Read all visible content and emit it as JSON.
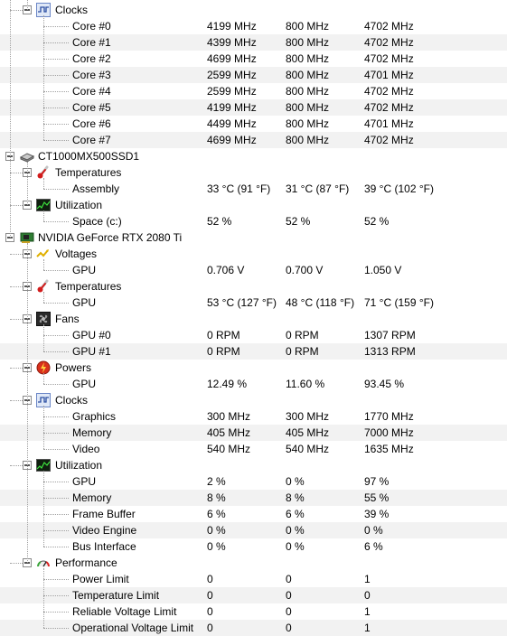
{
  "tree": [
    {
      "level": 1,
      "type": "group",
      "icon": "clock-wave-icon",
      "label": "Clocks"
    },
    {
      "level": 2,
      "type": "leaf",
      "label": "Core #0",
      "v1": "4199 MHz",
      "v2": "800 MHz",
      "v3": "4702 MHz"
    },
    {
      "level": 2,
      "type": "leaf",
      "label": "Core #1",
      "v1": "4399 MHz",
      "v2": "800 MHz",
      "v3": "4702 MHz"
    },
    {
      "level": 2,
      "type": "leaf",
      "label": "Core #2",
      "v1": "4699 MHz",
      "v2": "800 MHz",
      "v3": "4702 MHz"
    },
    {
      "level": 2,
      "type": "leaf",
      "label": "Core #3",
      "v1": "2599 MHz",
      "v2": "800 MHz",
      "v3": "4701 MHz"
    },
    {
      "level": 2,
      "type": "leaf",
      "label": "Core #4",
      "v1": "2599 MHz",
      "v2": "800 MHz",
      "v3": "4702 MHz"
    },
    {
      "level": 2,
      "type": "leaf",
      "label": "Core #5",
      "v1": "4199 MHz",
      "v2": "800 MHz",
      "v3": "4702 MHz"
    },
    {
      "level": 2,
      "type": "leaf",
      "label": "Core #6",
      "v1": "4499 MHz",
      "v2": "800 MHz",
      "v3": "4701 MHz"
    },
    {
      "level": 2,
      "type": "leaf",
      "label": "Core #7",
      "v1": "4699 MHz",
      "v2": "800 MHz",
      "v3": "4702 MHz"
    },
    {
      "level": 0,
      "type": "device",
      "icon": "ssd-drive-icon",
      "label": "CT1000MX500SSD1"
    },
    {
      "level": 1,
      "type": "group",
      "icon": "thermometer-icon",
      "label": "Temperatures"
    },
    {
      "level": 2,
      "type": "leaf",
      "label": "Assembly",
      "v1": "33 °C  (91 °F)",
      "v2": "31 °C  (87 °F)",
      "v3": "39 °C  (102 °F)"
    },
    {
      "level": 1,
      "type": "group",
      "icon": "utilization-graph-icon",
      "label": "Utilization"
    },
    {
      "level": 2,
      "type": "leaf",
      "label": "Space (c:)",
      "v1": "52 %",
      "v2": "52 %",
      "v3": "52 %"
    },
    {
      "level": 0,
      "type": "device",
      "icon": "gpu-card-icon",
      "label": "NVIDIA GeForce RTX 2080 Ti"
    },
    {
      "level": 1,
      "type": "group",
      "icon": "voltage-icon",
      "label": "Voltages"
    },
    {
      "level": 2,
      "type": "leaf",
      "label": "GPU",
      "v1": "0.706 V",
      "v2": "0.700 V",
      "v3": "1.050 V"
    },
    {
      "level": 1,
      "type": "group",
      "icon": "thermometer-icon",
      "label": "Temperatures"
    },
    {
      "level": 2,
      "type": "leaf",
      "label": "GPU",
      "v1": "53 °C  (127 °F)",
      "v2": "48 °C  (118 °F)",
      "v3": "71 °C  (159 °F)"
    },
    {
      "level": 1,
      "type": "group",
      "icon": "fan-icon",
      "label": "Fans"
    },
    {
      "level": 2,
      "type": "leaf",
      "label": "GPU #0",
      "v1": "0 RPM",
      "v2": "0 RPM",
      "v3": "1307 RPM"
    },
    {
      "level": 2,
      "type": "leaf",
      "label": "GPU #1",
      "v1": "0 RPM",
      "v2": "0 RPM",
      "v3": "1313 RPM"
    },
    {
      "level": 1,
      "type": "group",
      "icon": "power-icon",
      "label": "Powers"
    },
    {
      "level": 2,
      "type": "leaf",
      "label": "GPU",
      "v1": "12.49 %",
      "v2": "11.60 %",
      "v3": "93.45 %"
    },
    {
      "level": 1,
      "type": "group",
      "icon": "clock-wave-icon",
      "label": "Clocks"
    },
    {
      "level": 2,
      "type": "leaf",
      "label": "Graphics",
      "v1": "300 MHz",
      "v2": "300 MHz",
      "v3": "1770 MHz"
    },
    {
      "level": 2,
      "type": "leaf",
      "label": "Memory",
      "v1": "405 MHz",
      "v2": "405 MHz",
      "v3": "7000 MHz"
    },
    {
      "level": 2,
      "type": "leaf",
      "label": "Video",
      "v1": "540 MHz",
      "v2": "540 MHz",
      "v3": "1635 MHz"
    },
    {
      "level": 1,
      "type": "group",
      "icon": "utilization-graph-icon",
      "label": "Utilization"
    },
    {
      "level": 2,
      "type": "leaf",
      "label": "GPU",
      "v1": "2 %",
      "v2": "0 %",
      "v3": "97 %"
    },
    {
      "level": 2,
      "type": "leaf",
      "label": "Memory",
      "v1": "8 %",
      "v2": "8 %",
      "v3": "55 %"
    },
    {
      "level": 2,
      "type": "leaf",
      "label": "Frame Buffer",
      "v1": "6 %",
      "v2": "6 %",
      "v3": "39 %"
    },
    {
      "level": 2,
      "type": "leaf",
      "label": "Video Engine",
      "v1": "0 %",
      "v2": "0 %",
      "v3": "0 %"
    },
    {
      "level": 2,
      "type": "leaf",
      "label": "Bus Interface",
      "v1": "0 %",
      "v2": "0 %",
      "v3": "6 %"
    },
    {
      "level": 1,
      "type": "group",
      "icon": "performance-gauge-icon",
      "label": "Performance"
    },
    {
      "level": 2,
      "type": "leaf",
      "label": "Power Limit",
      "v1": "0",
      "v2": "0",
      "v3": "1"
    },
    {
      "level": 2,
      "type": "leaf",
      "label": "Temperature Limit",
      "v1": "0",
      "v2": "0",
      "v3": "0"
    },
    {
      "level": 2,
      "type": "leaf",
      "label": "Reliable Voltage Limit",
      "v1": "0",
      "v2": "0",
      "v3": "1"
    },
    {
      "level": 2,
      "type": "leaf",
      "label": "Operational Voltage Limit",
      "v1": "0",
      "v2": "0",
      "v3": "1"
    }
  ]
}
